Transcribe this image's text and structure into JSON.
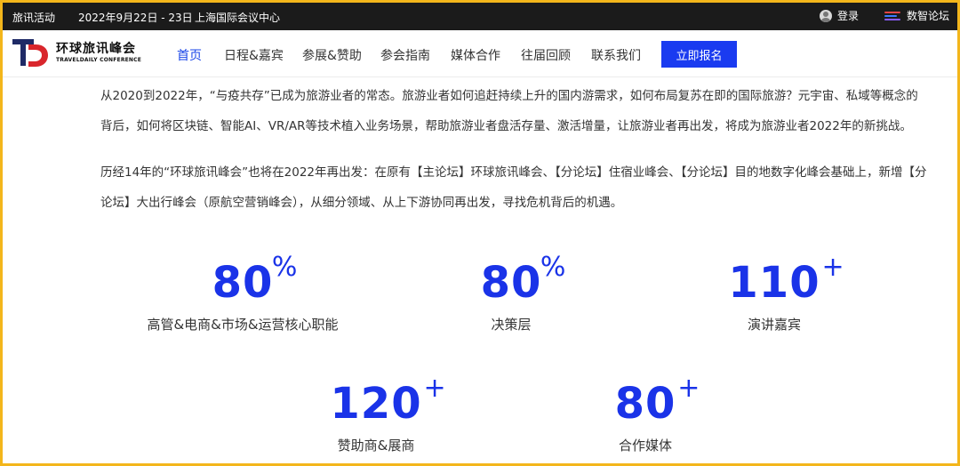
{
  "topbar": {
    "event_label": "旅讯活动",
    "date": "2022年9月22日 - 23日",
    "venue": "上海国际会议中心",
    "login": "登录",
    "forum": "数智论坛"
  },
  "logo": {
    "name_cn": "环球旅讯峰会",
    "name_en": "TRAVELDAILY CONFERENCE"
  },
  "nav": {
    "items": [
      {
        "label": "首页",
        "active": true
      },
      {
        "label": "日程&嘉宾"
      },
      {
        "label": "参展&赞助"
      },
      {
        "label": "参会指南"
      },
      {
        "label": "媒体合作"
      },
      {
        "label": "往届回顾"
      },
      {
        "label": "联系我们"
      }
    ],
    "cta": "立即报名"
  },
  "content": {
    "paragraph1": "从2020到2022年，“与疫共存”已成为旅游业者的常态。旅游业者如何追赶持续上升的国内游需求，如何布局复苏在即的国际旅游？元宇宙、私域等概念的背后，如何将区块链、智能AI、VR/AR等技术植入业务场景，帮助旅游业者盘活存量、激活增量，让旅游业者再出发，将成为旅游业者2022年的新挑战。",
    "paragraph2": "历经14年的“环球旅讯峰会”也将在2022年再出发：在原有【主论坛】环球旅讯峰会、【分论坛】住宿业峰会、【分论坛】目的地数字化峰会基础上，新增【分论坛】大出行峰会（原航空营销峰会），从细分领域、从上下游协同再出发，寻找危机背后的机遇。"
  },
  "stats": [
    {
      "value": "80",
      "suffix": "%",
      "label": "高管&电商&市场&运营核心职能"
    },
    {
      "value": "80",
      "suffix": "%",
      "label": "决策层"
    },
    {
      "value": "110",
      "suffix": "+",
      "label": "演讲嘉宾"
    },
    {
      "value": "120",
      "suffix": "+",
      "label": "赞助商&展商"
    },
    {
      "value": "80",
      "suffix": "+",
      "label": "合作媒体"
    }
  ],
  "colors": {
    "accent": "#1a3bf0",
    "stat_blue": "#1a33e8",
    "frame_border": "#f3b61b",
    "topbar_bg": "#1b1b1b",
    "logo_red": "#d9262c",
    "logo_navy": "#1f2a66"
  }
}
